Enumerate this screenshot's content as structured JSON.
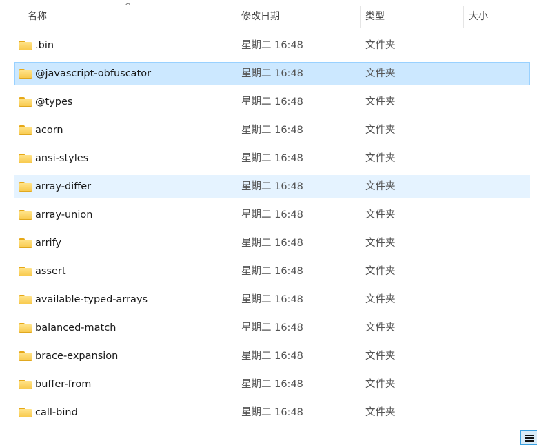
{
  "columns": {
    "name": "名称",
    "modified": "修改日期",
    "type": "类型",
    "size": "大小"
  },
  "sort_indicator": "^",
  "rows": [
    {
      "name": ".bin",
      "modified": "星期二 16:48",
      "type": "文件夹",
      "state": ""
    },
    {
      "name": "@javascript-obfuscator",
      "modified": "星期二 16:48",
      "type": "文件夹",
      "state": "selected"
    },
    {
      "name": "@types",
      "modified": "星期二 16:48",
      "type": "文件夹",
      "state": ""
    },
    {
      "name": "acorn",
      "modified": "星期二 16:48",
      "type": "文件夹",
      "state": ""
    },
    {
      "name": "ansi-styles",
      "modified": "星期二 16:48",
      "type": "文件夹",
      "state": ""
    },
    {
      "name": "array-differ",
      "modified": "星期二 16:48",
      "type": "文件夹",
      "state": "hover"
    },
    {
      "name": "array-union",
      "modified": "星期二 16:48",
      "type": "文件夹",
      "state": ""
    },
    {
      "name": "arrify",
      "modified": "星期二 16:48",
      "type": "文件夹",
      "state": ""
    },
    {
      "name": "assert",
      "modified": "星期二 16:48",
      "type": "文件夹",
      "state": ""
    },
    {
      "name": "available-typed-arrays",
      "modified": "星期二 16:48",
      "type": "文件夹",
      "state": ""
    },
    {
      "name": "balanced-match",
      "modified": "星期二 16:48",
      "type": "文件夹",
      "state": ""
    },
    {
      "name": "brace-expansion",
      "modified": "星期二 16:48",
      "type": "文件夹",
      "state": ""
    },
    {
      "name": "buffer-from",
      "modified": "星期二 16:48",
      "type": "文件夹",
      "state": ""
    },
    {
      "name": "call-bind",
      "modified": "星期二 16:48",
      "type": "文件夹",
      "state": ""
    }
  ]
}
